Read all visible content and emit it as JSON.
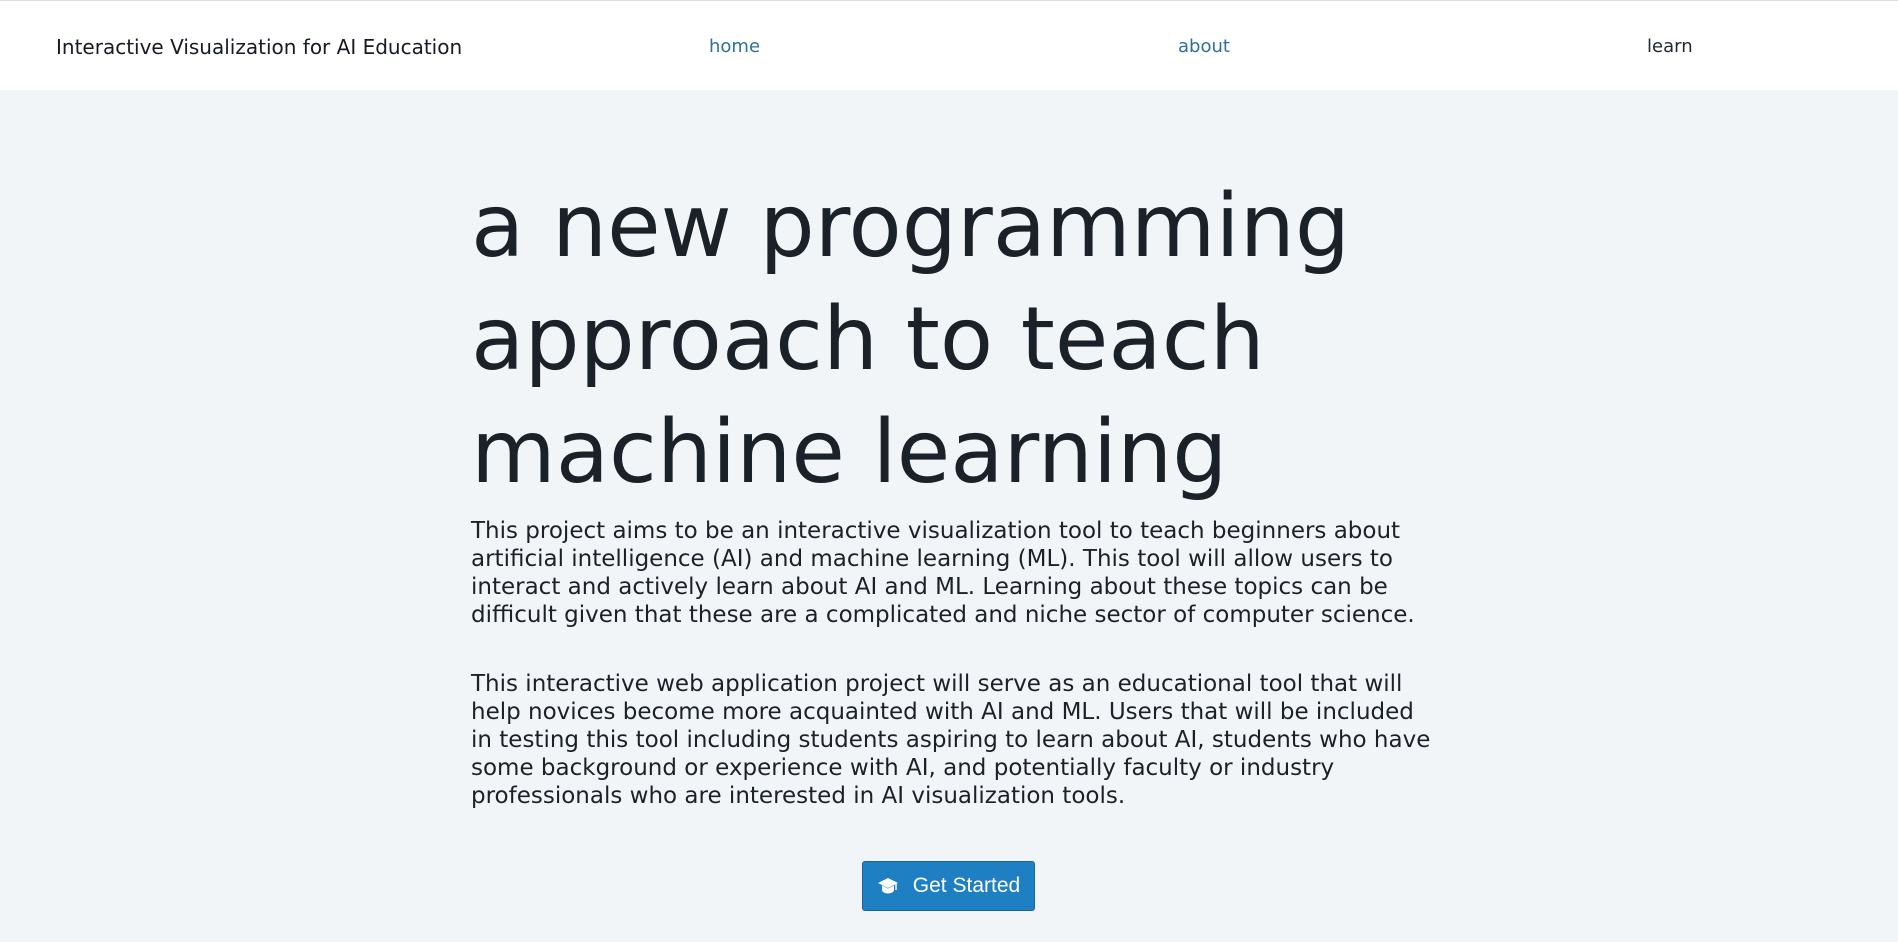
{
  "navbar": {
    "brand": "Interactive Visualization for AI Education",
    "links": [
      {
        "label": "home",
        "color": "#2f6f9f"
      },
      {
        "label": "about",
        "color": "#2f6f9f"
      },
      {
        "label": "learn",
        "color": "#1f262d"
      }
    ]
  },
  "hero": {
    "title_lines": [
      "a new programming",
      "approach to teach",
      "machine learning"
    ],
    "paragraphs": [
      "This project aims to be an interactive visualization tool to teach beginners about artificial intelligence (AI) and machine learning (ML). This tool will allow users to interact and actively learn about AI and ML. Learning about these topics can be difficult given that these are a complicated and niche sector of computer science.",
      "This interactive web application project will serve as an educational tool that will help novices become more acquainted with AI and ML. Users that will be included in testing this tool including students aspiring to learn about AI, students who have some background or experience with AI, and potentially faculty or industry professionals who are interested in AI visualization tools."
    ],
    "cta": {
      "label": "Get Started",
      "icon": "graduation-cap-icon"
    }
  },
  "colors": {
    "background": "#f2f5f8",
    "navbar": "#ffffff",
    "link": "#2f6f9f",
    "button": "#1f7fc3",
    "text": "#1b2128"
  }
}
